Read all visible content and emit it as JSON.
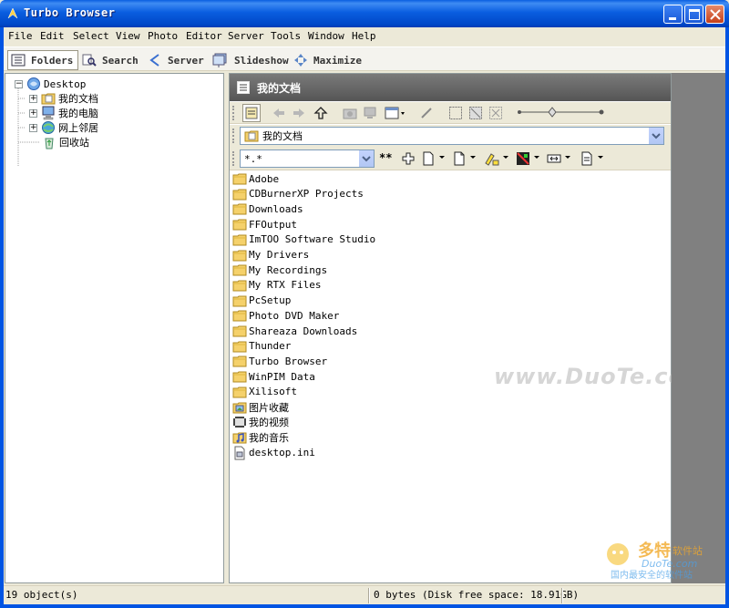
{
  "window": {
    "title": "Turbo Browser"
  },
  "menu": [
    {
      "label": "File"
    },
    {
      "label": "Edit"
    },
    {
      "label": "Select"
    },
    {
      "label": "View"
    },
    {
      "label": "Photo"
    },
    {
      "label": "Editor"
    },
    {
      "label": "Server"
    },
    {
      "label": "Tools"
    },
    {
      "label": "Window"
    },
    {
      "label": "Help"
    }
  ],
  "toolbar": {
    "folders": "Folders",
    "search": "Search",
    "server": "Server",
    "slideshow": "Slideshow",
    "maximize": "Maximize"
  },
  "tree": {
    "root": "Desktop",
    "items": [
      {
        "label": "我的文档",
        "icon": "my-documents-icon",
        "expander": "+"
      },
      {
        "label": "我的电脑",
        "icon": "my-computer-icon",
        "expander": "+"
      },
      {
        "label": "网上邻居",
        "icon": "network-places-icon",
        "expander": "+"
      },
      {
        "label": "回收站",
        "icon": "recycle-bin-icon",
        "expander": ""
      }
    ]
  },
  "pane": {
    "header": "我的文档",
    "address": "我的文档",
    "filter": "*.*",
    "filter_extra": "**"
  },
  "files": [
    {
      "name": "Adobe",
      "icon": "folder-icon"
    },
    {
      "name": "CDBurnerXP Projects",
      "icon": "folder-icon"
    },
    {
      "name": "Downloads",
      "icon": "folder-icon"
    },
    {
      "name": "FFOutput",
      "icon": "folder-icon"
    },
    {
      "name": "ImTOO Software Studio",
      "icon": "folder-icon"
    },
    {
      "name": "My Drivers",
      "icon": "folder-icon"
    },
    {
      "name": "My Recordings",
      "icon": "folder-icon"
    },
    {
      "name": "My RTX Files",
      "icon": "folder-icon"
    },
    {
      "name": "PcSetup",
      "icon": "folder-icon"
    },
    {
      "name": "Photo DVD Maker",
      "icon": "folder-icon"
    },
    {
      "name": "Shareaza Downloads",
      "icon": "folder-icon"
    },
    {
      "name": "Thunder",
      "icon": "folder-icon"
    },
    {
      "name": "Turbo Browser",
      "icon": "folder-icon"
    },
    {
      "name": "WinPIM Data",
      "icon": "folder-icon"
    },
    {
      "name": "Xilisoft",
      "icon": "folder-icon"
    },
    {
      "name": "图片收藏",
      "icon": "my-pictures-icon"
    },
    {
      "name": "我的视频",
      "icon": "my-videos-icon"
    },
    {
      "name": "我的音乐",
      "icon": "my-music-icon"
    },
    {
      "name": "desktop.ini",
      "icon": "ini-file-icon"
    }
  ],
  "watermark": "www.DuoTe.com",
  "logo_watermark": {
    "brand": "多特",
    "suffix": "软件站",
    "url": "DuoTe.com",
    "tagline": "国内最安全的软件站"
  },
  "status": {
    "objects": "19 object(s)",
    "space": "0 bytes (Disk free space: 18.91GB)"
  },
  "colors": {
    "titlebar": "#0a5ee0",
    "pane_header": "#6b6b6b",
    "folder": "#f5d16b"
  }
}
